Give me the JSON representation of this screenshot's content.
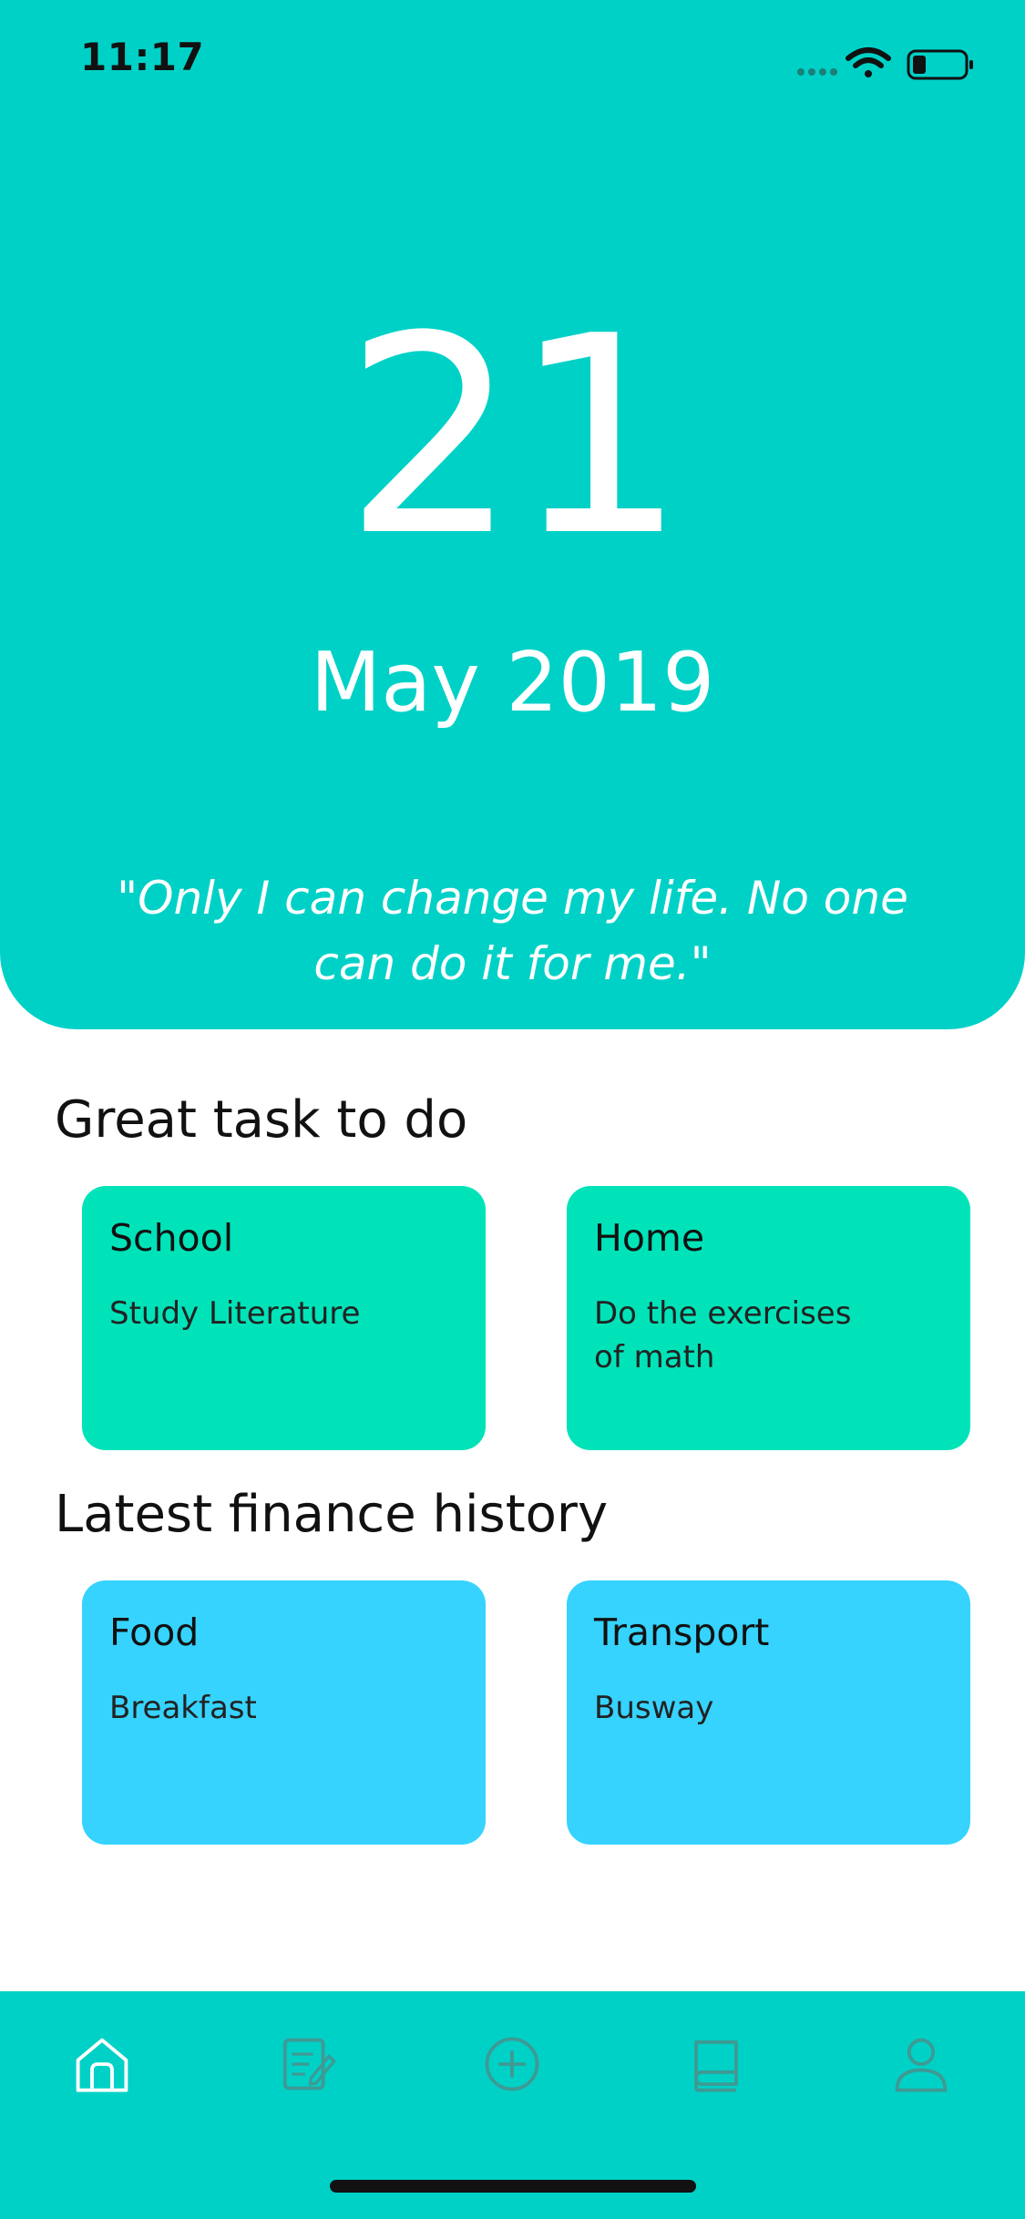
{
  "status_bar": {
    "time": "11:17",
    "icons": [
      "signal-icon",
      "wifi-icon",
      "battery-icon"
    ]
  },
  "header": {
    "day": "21",
    "month_year": "May 2019",
    "quote": "\"Only I can change my life. No one can do it for me.\""
  },
  "tasks": {
    "title": "Great task to do",
    "cards": [
      {
        "title": "School",
        "subtitle": "Study Literature"
      },
      {
        "title": "Home",
        "subtitle": "Do the exercises of math"
      }
    ]
  },
  "finance": {
    "title": "Latest finance history",
    "cards": [
      {
        "title": "Food",
        "subtitle": "Breakfast"
      },
      {
        "title": "Transport",
        "subtitle": "Busway"
      }
    ]
  },
  "tabbar": {
    "items": [
      {
        "icon": "home-icon",
        "active": true
      },
      {
        "icon": "notes-icon",
        "active": false
      },
      {
        "icon": "add-circle-icon",
        "active": false
      },
      {
        "icon": "book-icon",
        "active": false
      },
      {
        "icon": "profile-icon",
        "active": false
      }
    ]
  },
  "colors": {
    "accent": "#00D1C7",
    "task_card": "#00E3B9",
    "finance_card": "#36D3FF",
    "tab_active": "#FFFFFF",
    "tab_inactive": "#3D9A94"
  }
}
